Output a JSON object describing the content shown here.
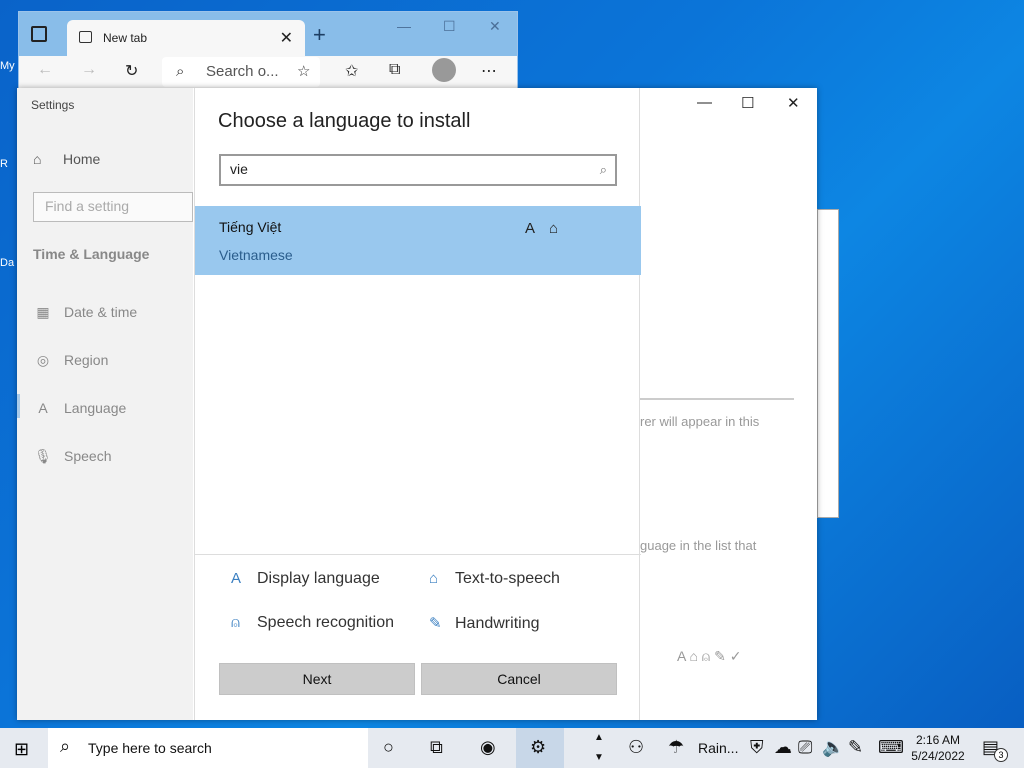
{
  "desktop": {
    "icon_labels": [
      "My",
      "R",
      "Da"
    ]
  },
  "edge": {
    "tab_label": "New tab",
    "tab_close": "✕",
    "new_tab": "+",
    "minimize": "—",
    "maximize": "☐",
    "close": "✕",
    "address_placeholder": "Search o..."
  },
  "settings": {
    "title": "Settings",
    "home": "Home",
    "find_placeholder": "Find a setting",
    "section": "Time & Language",
    "nav": [
      {
        "label": "Date & time",
        "icon": "calendar-icon"
      },
      {
        "label": "Region",
        "icon": "globe-icon"
      },
      {
        "label": "Language",
        "icon": "language-icon"
      },
      {
        "label": "Speech",
        "icon": "microphone-icon"
      }
    ],
    "minimize": "—",
    "maximize": "☐",
    "close": "✕",
    "faded_text_1": "rer will appear in this",
    "faded_text_2": "guage in the list that"
  },
  "dialog": {
    "title": "Choose a language to install",
    "search_value": "vie",
    "results": [
      {
        "native": "Tiếng Việt",
        "english": "Vietnamese"
      }
    ],
    "features": [
      {
        "label": "Display language",
        "icon": "display-language-icon"
      },
      {
        "label": "Text-to-speech",
        "icon": "text-to-speech-icon"
      },
      {
        "label": "Speech recognition",
        "icon": "microphone-icon"
      },
      {
        "label": "Handwriting",
        "icon": "handwriting-icon"
      }
    ],
    "next": "Next",
    "cancel": "Cancel"
  },
  "taskbar": {
    "search_placeholder": "Type here to search",
    "weather": "Rain...",
    "time": "2:16 AM",
    "date": "5/24/2022",
    "notification_count": "3"
  }
}
